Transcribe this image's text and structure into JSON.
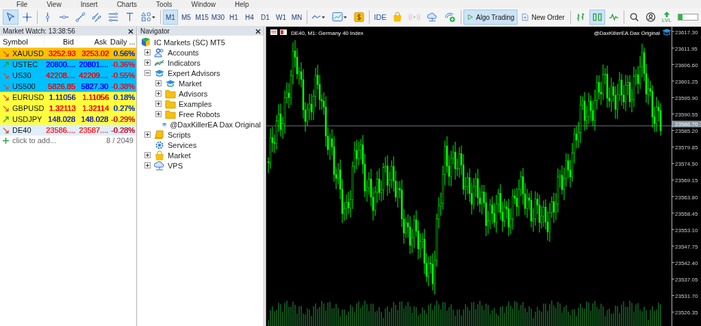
{
  "menu": [
    "File",
    "View",
    "Insert",
    "Charts",
    "Tools",
    "Window",
    "Help"
  ],
  "drawing_tools": [
    {
      "kind": "cursor",
      "selected": true
    },
    {
      "kind": "crosshair",
      "selected": false
    },
    {
      "kind": "vline",
      "selected": false
    },
    {
      "kind": "hline",
      "selected": false
    },
    {
      "kind": "trend",
      "selected": false
    },
    {
      "kind": "channel",
      "selected": false
    },
    {
      "kind": "fibo",
      "selected": false
    },
    {
      "kind": "text",
      "selected": false
    },
    {
      "kind": "shapes",
      "selected": false
    }
  ],
  "timeframes": [
    {
      "label": "M1",
      "selected": true
    },
    {
      "label": "M5",
      "selected": false
    },
    {
      "label": "M15",
      "selected": false
    },
    {
      "label": "M30",
      "selected": false
    },
    {
      "label": "H1",
      "selected": false
    },
    {
      "label": "H4",
      "selected": false
    },
    {
      "label": "D1",
      "selected": false
    },
    {
      "label": "W1",
      "selected": false
    },
    {
      "label": "MN",
      "selected": false
    }
  ],
  "ide_label": "IDE",
  "algo_trading": {
    "label": "Algo Trading",
    "on": true
  },
  "new_order": {
    "label": "New Order"
  },
  "chart_types": [
    {
      "kind": "bars",
      "selected": false
    },
    {
      "kind": "candles",
      "selected": true
    },
    {
      "kind": "line",
      "selected": false
    }
  ],
  "lvl_label": "LVL",
  "meter": {
    "level": 0.2
  },
  "market_watch": {
    "title": "Market Watch: 13:38:56",
    "columns": [
      "Symbol",
      "Bid",
      "Ask",
      "Daily ..."
    ],
    "rows": [
      {
        "symbol": "XAUUSD",
        "kind": "down",
        "color": "#ffc000",
        "bid": {
          "text": "3252.93",
          "color": "#ff0000"
        },
        "ask": {
          "text": "3253.02",
          "color": "#ff0000"
        },
        "change": {
          "text": "0.56%",
          "color": "#1a3bb0"
        }
      },
      {
        "symbol": "USTEC",
        "kind": "up",
        "color": "#00bfff",
        "bid": {
          "text": "20800....",
          "color": "#0000ff"
        },
        "ask": {
          "text": "20801....",
          "color": "#0000ff"
        },
        "change": {
          "text": "-0.36%",
          "color": "#c8203a"
        }
      },
      {
        "symbol": "US30",
        "kind": "down",
        "color": "#00bfff",
        "bid": {
          "text": "42208....",
          "color": "#ff0000"
        },
        "ask": {
          "text": "42209....",
          "color": "#ff0000"
        },
        "change": {
          "text": "-0.55%",
          "color": "#c8203a"
        }
      },
      {
        "symbol": "US500",
        "kind": "down",
        "color": "#00bfff",
        "bid": {
          "text": "5826.85",
          "color": "#ff0000"
        },
        "ask": {
          "text": "5827.30",
          "color": "#0000ff"
        },
        "change": {
          "text": "-0.38%",
          "color": "#c8203a"
        }
      },
      {
        "symbol": "EURUSD",
        "kind": "down",
        "color": "#ffff40",
        "bid": {
          "text": "1.11056",
          "color": "#2a2aa0"
        },
        "ask": {
          "text": "1.11056",
          "color": "#ff0000"
        },
        "change": {
          "text": "0.18%",
          "color": "#1a3bb0"
        }
      },
      {
        "symbol": "GBPUSD",
        "kind": "down",
        "color": "#ffff40",
        "bid": {
          "text": "1.32113",
          "color": "#ff0000"
        },
        "ask": {
          "text": "1.32114",
          "color": "#ff0000"
        },
        "change": {
          "text": "0.27%",
          "color": "#1a3bb0"
        }
      },
      {
        "symbol": "USDJPY",
        "kind": "up",
        "color": "#ffff40",
        "bid": {
          "text": "148.028",
          "color": "#2a2aa0"
        },
        "ask": {
          "text": "148.028",
          "color": "#2a2aa0"
        },
        "change": {
          "text": "-0.29%",
          "color": "#c8203a"
        }
      },
      {
        "symbol": "DE40",
        "kind": "down",
        "color": "#e0eefa",
        "bid": {
          "text": "23586....",
          "color": "#ff3030"
        },
        "ask": {
          "text": "23587....",
          "color": "#ff3030"
        },
        "change": {
          "text": "-0.28%",
          "color": "#c8203a"
        }
      }
    ],
    "add_label": "click to add...",
    "count": "8 / 2049"
  },
  "navigator": {
    "title": "Navigator",
    "items": [
      {
        "label": "IC Markets (SC) MT5",
        "kind": "broker",
        "children": [
          {
            "label": "Accounts",
            "kind": "accounts",
            "expanded": false
          },
          {
            "label": "Indicators",
            "kind": "indicators",
            "expanded": false
          },
          {
            "label": "Expert Advisors",
            "kind": "experts",
            "expanded": true,
            "children": [
              {
                "label": "Market",
                "kind": "experts",
                "expanded": false
              },
              {
                "label": "Advisors",
                "kind": "folder",
                "expanded": false
              },
              {
                "label": "Examples",
                "kind": "folder",
                "expanded": false
              },
              {
                "label": "Free Robots",
                "kind": "folder",
                "expanded": false
              },
              {
                "label": "@DaxKillerEA Dax Original",
                "kind": "experts"
              }
            ]
          },
          {
            "label": "Scripts",
            "kind": "scripts",
            "expanded": false
          },
          {
            "label": "Services",
            "kind": "services"
          },
          {
            "label": "Market",
            "kind": "market",
            "expanded": false
          },
          {
            "label": "VPS",
            "kind": "vps",
            "expanded": false
          }
        ]
      }
    ]
  },
  "chart": {
    "title": "DE40, M1:  Germany 40 Index",
    "expert": "@DaxKillerEA Dax Original",
    "current_price": "23586.70",
    "price_labels": [
      "23617.30",
      "23611.95",
      "23606.60",
      "23601.25",
      "23595.90",
      "23590.55",
      "23585.20",
      "23579.85",
      "23574.50",
      "23569.15",
      "23563.80",
      "23558.45",
      "23553.10",
      "23547.75",
      "23542.40",
      "23537.05",
      "23531.70",
      "23526.35"
    ]
  }
}
